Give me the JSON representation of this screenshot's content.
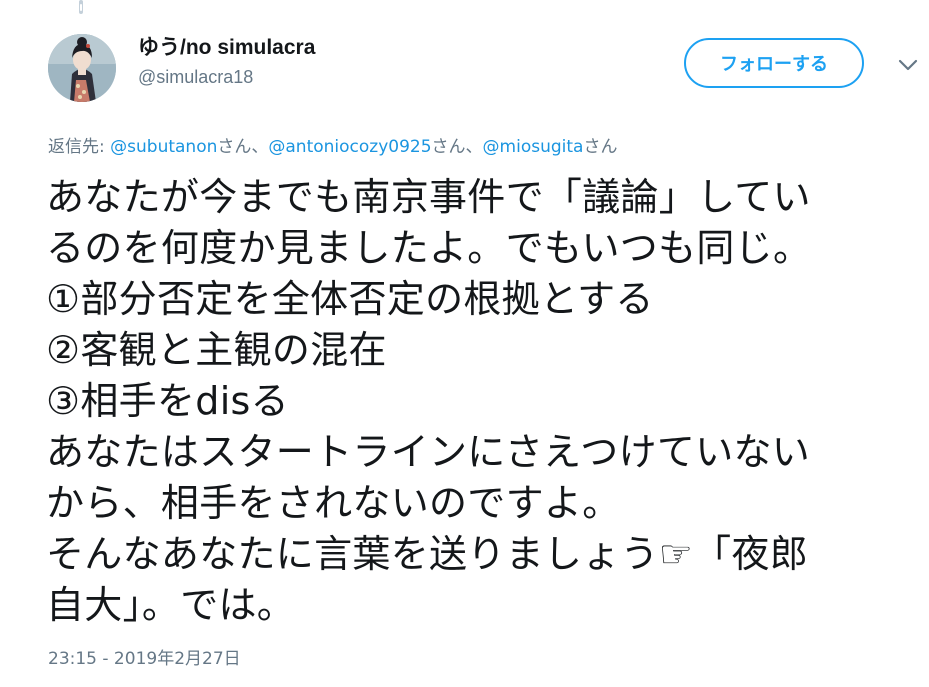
{
  "tweet": {
    "author": {
      "display_name": "ゆう/no simulacra",
      "handle": "@simulacra18"
    },
    "follow_label": "フォローする",
    "reply": {
      "prefix": "返信先: ",
      "mentions": [
        "@subutanon",
        "@antoniocozy0925",
        "@miosugita"
      ],
      "suffixes": [
        "さん、",
        "さん、",
        "さん"
      ]
    },
    "text_lines": [
      "あなたが今までも南京事件で「議論」してい",
      "るのを何度か見ましたよ。でもいつも同じ。",
      "①部分否定を全体否定の根拠とする",
      "②客観と主観の混在",
      "③相手をdisる",
      "あなたはスタートラインにさえつけていない",
      "から、相手をされないのですよ。",
      "そんなあなたに言葉を送りましょう☞「夜郎",
      "自大」。では。"
    ],
    "timestamp": "23:15 - 2019年2月27日"
  },
  "colors": {
    "accent": "#1da1f2",
    "mention": "#1b95e0",
    "secondary_text": "#657786",
    "primary_text": "#14171a"
  },
  "icons": {
    "avatar": "avatar-illustration",
    "caret": "chevron-down-icon",
    "connector": "thread-connector-icon"
  }
}
